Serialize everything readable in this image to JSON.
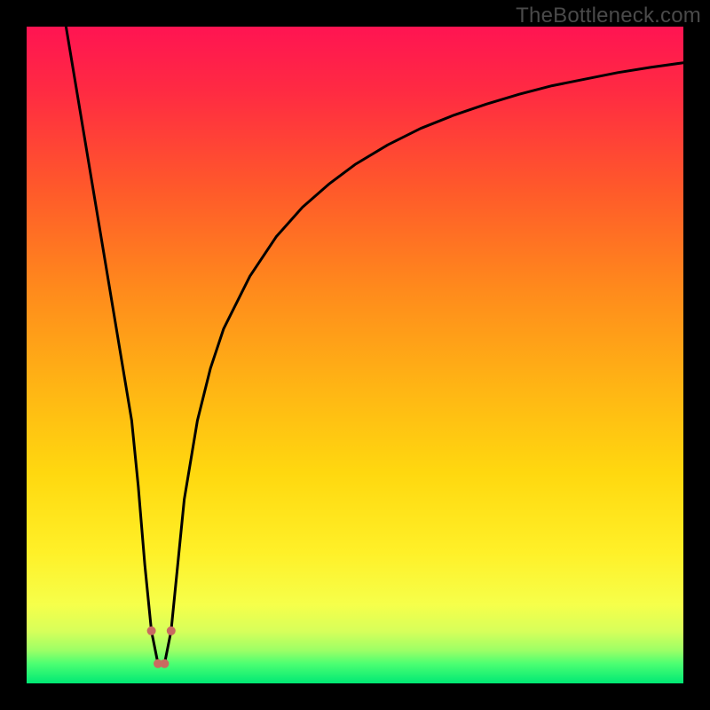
{
  "watermark": "TheBottleneck.com",
  "colors": {
    "curve_stroke": "#000000",
    "marker_fill": "#c96a60",
    "frame_bg": "#000000"
  },
  "chart_data": {
    "type": "line",
    "title": "",
    "xlabel": "",
    "ylabel": "",
    "xlim": [
      0,
      100
    ],
    "ylim": [
      0,
      100
    ],
    "x": [
      6,
      8,
      10,
      12,
      14,
      16,
      17,
      18,
      19,
      20,
      21,
      22,
      23,
      24,
      26,
      28,
      30,
      34,
      38,
      42,
      46,
      50,
      55,
      60,
      65,
      70,
      75,
      80,
      85,
      90,
      95,
      100
    ],
    "values": [
      100,
      88,
      76,
      64,
      52,
      40,
      30,
      18,
      8,
      3,
      3,
      8,
      18,
      28,
      40,
      48,
      54,
      62,
      68,
      72.5,
      76,
      79,
      82,
      84.5,
      86.5,
      88.2,
      89.7,
      91,
      92,
      93,
      93.8,
      94.5
    ],
    "markers_x": [
      19,
      20,
      21,
      22
    ],
    "markers_size": [
      5,
      5,
      5,
      5
    ]
  }
}
